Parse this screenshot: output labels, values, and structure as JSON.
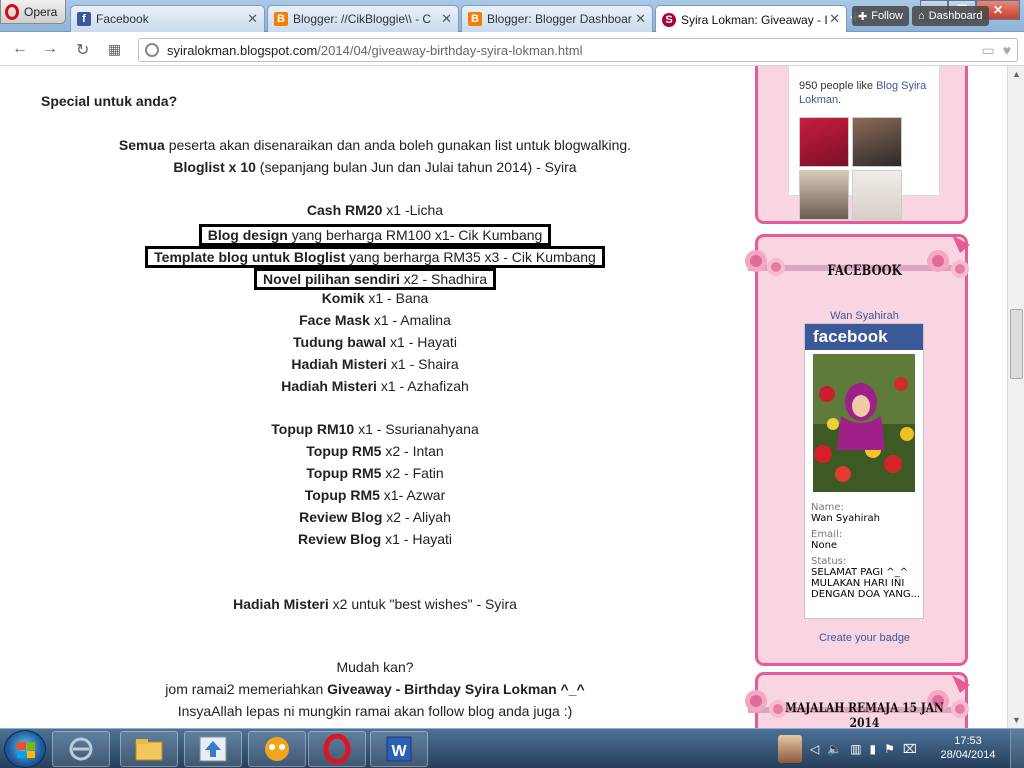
{
  "browser": {
    "menu_label": "Opera",
    "tabs": [
      {
        "title": "Facebook",
        "icon": "facebook-icon",
        "color": "#3b5998"
      },
      {
        "title": "Blogger: //CikBloggie\\\\ - C",
        "icon": "blogger-icon",
        "color": "#f57d00"
      },
      {
        "title": "Blogger: Blogger Dashboar",
        "icon": "blogger-icon",
        "color": "#f57d00"
      },
      {
        "title": "Syira Lokman: Giveaway - I",
        "icon": "site-icon",
        "color": "#a4003d"
      }
    ],
    "new_tab_label": "+",
    "url_host": "syiralokman.blogspot.com",
    "url_path": "/2014/04/giveaway-birthday-syira-lokman.html"
  },
  "post": {
    "heading": "Special untuk anda?",
    "lines": [
      {
        "bold": "Semua",
        "rest": " peserta akan disenaraikan dan anda boleh gunakan list untuk blogwalking."
      },
      {
        "bold": "Bloglist x 10",
        "rest": " (sepanjang bulan Jun dan Julai tahun 2014) - Syira"
      },
      {
        "bold": "Cash RM20",
        "rest": " x1 -Licha"
      },
      {
        "bold": "Blog design",
        "rest": " yang berharga RM100 x1- Cik Kumbang",
        "boxed": true
      },
      {
        "bold": "Template blog untuk Bloglist",
        "rest": " yang berharga RM35 x3 - Cik Kumbang",
        "boxed": true
      },
      {
        "bold": "Novel pilihan sendiri",
        "rest": " x2 - Shadhira",
        "boxed": true
      },
      {
        "bold": "Komik",
        "rest": " x1 - Bana"
      },
      {
        "bold": "Face Mask",
        "rest": " x1 - Amalina"
      },
      {
        "bold": "Tudung bawal",
        "rest": " x1 - Hayati"
      },
      {
        "bold": "Hadiah Misteri",
        "rest": " x1 - Shaira"
      },
      {
        "bold": "Hadiah Misteri",
        "rest": " x1 - Azhafizah"
      },
      {
        "bold": "Topup RM10",
        "rest": " x1 - Ssurianahyana"
      },
      {
        "bold": "Topup RM5",
        "rest": " x2 - Intan"
      },
      {
        "bold": "Topup RM5",
        "rest": " x2 - Fatin"
      },
      {
        "bold": "Topup RM5",
        "rest": " x1- Azwar"
      },
      {
        "bold": "Review Blog",
        "rest": " x2 - Aliyah"
      },
      {
        "bold": "Review Blog",
        "rest": " x1 - Hayati"
      },
      {
        "bold": "Hadiah Misteri",
        "rest": " x2 untuk \"best wishes\" - Syira"
      },
      {
        "bold": "",
        "rest": "Mudah kan?"
      },
      {
        "pre": "jom ramai2 memeriahkan ",
        "bold": "Giveaway - Birthday Syira Lokman ^_^",
        "rest": ""
      },
      {
        "bold": "",
        "rest": "InsyaAllah lepas ni mungkin ramai akan follow blog anda juga :)"
      }
    ]
  },
  "sidebar": {
    "top_widget": {
      "like_count_text": "950 people like ",
      "like_link": "Blog Syira Lokman",
      "like_suffix": "."
    },
    "follow_button": "Follow",
    "dashboard_button": "Dashboard",
    "facebook_widget": {
      "title": "FACEBOOK",
      "profile_name": "Wan Syahirah",
      "badge_brand": "facebook",
      "name_label": "Name:",
      "name_value": "Wan Syahirah",
      "email_label": "Email:",
      "email_value": "None",
      "status_label": "Status:",
      "status_value": "SELAMAT PAGI ^_^ MULAKAN HARI INI DENGAN DOA YANG...",
      "create_badge_link": "Create your badge"
    },
    "magazine_widget": {
      "title": "MAJALAH REMAJA 15 JAN 2014"
    }
  },
  "taskbar": {
    "apps": [
      {
        "name": "taskbar-app-ie-icon"
      },
      {
        "name": "taskbar-app-explorer-icon"
      },
      {
        "name": "taskbar-app-upload-icon"
      },
      {
        "name": "taskbar-app-messenger-icon"
      },
      {
        "name": "taskbar-app-opera-icon"
      },
      {
        "name": "taskbar-app-word-icon"
      }
    ],
    "time": "17:53",
    "date": "28/04/2014"
  },
  "colors": {
    "sidebar_pink": "#f9d4e1",
    "sidebar_border": "#e75b95",
    "facebook_blue": "#3b5998"
  }
}
